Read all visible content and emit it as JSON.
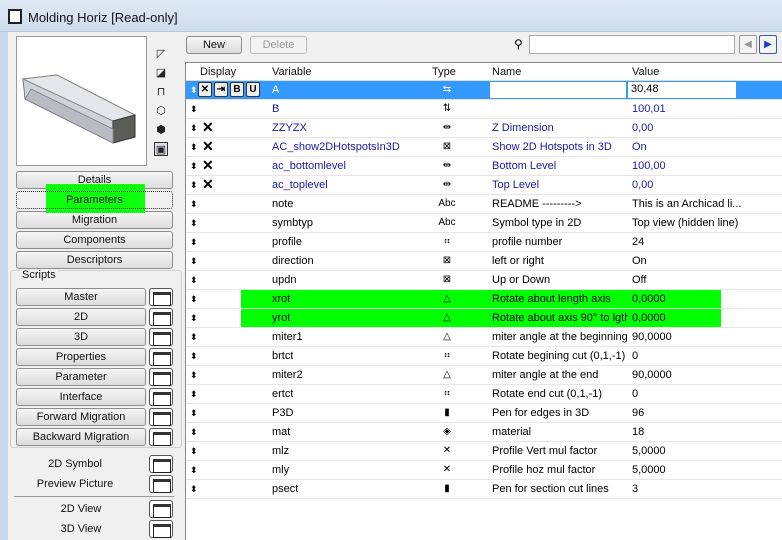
{
  "window": {
    "title": "Molding Horiz [Read-only]"
  },
  "colors": {
    "highlight": "#00ff00",
    "selection": "#3399ff",
    "link_text": "#1a1aa8"
  },
  "left": {
    "view_icons": [
      "plan-icon",
      "section-icon",
      "elevation-icon",
      "wireframe-icon",
      "shaded-icon",
      "preview-icon"
    ],
    "tabs": [
      "Details",
      "Parameters",
      "Migration",
      "Components",
      "Descriptors"
    ],
    "scripts_label": "Scripts",
    "scripts": [
      "Master",
      "2D",
      "3D",
      "Properties",
      "Parameter",
      "Interface",
      "Forward Migration",
      "Backward Migration"
    ],
    "extras": [
      "2D Symbol",
      "Preview Picture"
    ],
    "views": [
      "2D View",
      "3D View"
    ]
  },
  "toolbar": {
    "new": "New",
    "delete": "Delete",
    "search_value": "",
    "search_placeholder": ""
  },
  "table": {
    "headers": [
      "Display",
      "Variable",
      "Type",
      "Name",
      "Value"
    ],
    "rows": [
      {
        "var": "A",
        "type": "⇆",
        "name": "",
        "value": "30,48",
        "hidden": true,
        "sel": true
      },
      {
        "var": "B",
        "type": "⇅",
        "name": "",
        "value": "100,01",
        "hidden": false,
        "blue": true
      },
      {
        "var": "ZZYZX",
        "type": "⇹",
        "name": "Z Dimension",
        "value": "0,00",
        "hidden": true,
        "blue": true
      },
      {
        "var": "AC_show2DHotspotsIn3D",
        "type": "⊠",
        "name": "Show 2D Hotspots in 3D",
        "value": "On",
        "hidden": true,
        "blue": true
      },
      {
        "var": "ac_bottomlevel",
        "type": "⇹",
        "name": "Bottom Level",
        "value": "100,00",
        "hidden": true,
        "blue": true
      },
      {
        "var": "ac_toplevel",
        "type": "⇹",
        "name": "Top Level",
        "value": "0,00",
        "hidden": true,
        "blue": true
      },
      {
        "var": "note",
        "type": "Abc",
        "name": "README --------->",
        "value": "This is an Archicad li..."
      },
      {
        "var": "symbtyp",
        "type": "Abc",
        "name": "Symbol type in 2D",
        "value": "Top view (hidden line)"
      },
      {
        "var": "profile",
        "type": "⠶",
        "name": "profile number",
        "value": "24"
      },
      {
        "var": "direction",
        "type": "⊠",
        "name": "left or right",
        "value": "On"
      },
      {
        "var": "updn",
        "type": "⊠",
        "name": "Up or Down",
        "value": "Off"
      },
      {
        "var": "xrot",
        "type": "△",
        "name": "Rotate about length axis",
        "value": "0,0000"
      },
      {
        "var": "yrot",
        "type": "△",
        "name": "Rotate about axis 90° to lgth",
        "value": "0,0000"
      },
      {
        "var": "miter1",
        "type": "△",
        "name": "miter angle at the beginning",
        "value": "90,0000"
      },
      {
        "var": "brtct",
        "type": "⠶",
        "name": "Rotate begining cut (0,1,-1)",
        "value": "0"
      },
      {
        "var": "miter2",
        "type": "△",
        "name": "miter angle at the end",
        "value": "90,0000"
      },
      {
        "var": "ertct",
        "type": "⠶",
        "name": "Rotate end cut (0,1,-1)",
        "value": "0"
      },
      {
        "var": "P3D",
        "type": "▮",
        "name": "Pen for edges in 3D",
        "value": "96"
      },
      {
        "var": "mat",
        "type": "◈",
        "name": "material",
        "value": "18"
      },
      {
        "var": "mlz",
        "type": "✕",
        "name": "Profile Vert mul factor",
        "value": "5,0000"
      },
      {
        "var": "mly",
        "type": "✕",
        "name": "Profile hoz mul factor",
        "value": "5,0000"
      },
      {
        "var": "psect",
        "type": "▮",
        "name": "Pen for section cut lines",
        "value": "3"
      }
    ]
  }
}
